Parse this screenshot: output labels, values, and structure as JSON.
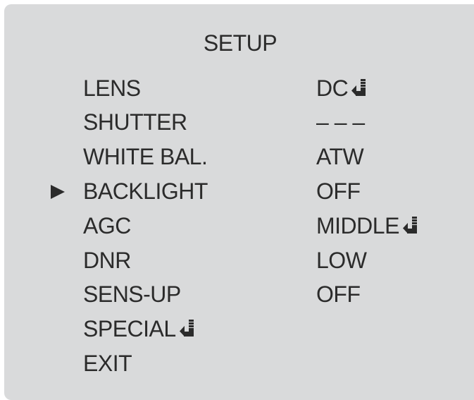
{
  "menu": {
    "title": "SETUP",
    "selected_index": 3,
    "items": [
      {
        "label": "LENS",
        "value": "DC",
        "label_has_submenu": false,
        "value_has_submenu": true
      },
      {
        "label": "SHUTTER",
        "value": "– – –",
        "label_has_submenu": false,
        "value_has_submenu": false
      },
      {
        "label": "WHITE BAL.",
        "value": "ATW",
        "label_has_submenu": false,
        "value_has_submenu": false
      },
      {
        "label": "BACKLIGHT",
        "value": "OFF",
        "label_has_submenu": false,
        "value_has_submenu": false
      },
      {
        "label": "AGC",
        "value": "MIDDLE",
        "label_has_submenu": false,
        "value_has_submenu": true
      },
      {
        "label": "DNR",
        "value": "LOW",
        "label_has_submenu": false,
        "value_has_submenu": false
      },
      {
        "label": "SENS-UP",
        "value": "OFF",
        "label_has_submenu": false,
        "value_has_submenu": false
      },
      {
        "label": "SPECIAL",
        "value": "",
        "label_has_submenu": true,
        "value_has_submenu": false
      },
      {
        "label": "EXIT",
        "value": "",
        "label_has_submenu": false,
        "value_has_submenu": false
      }
    ]
  },
  "icons": {
    "cursor": "selection-arrow-icon",
    "submenu": "enter-icon"
  },
  "colors": {
    "panel_background": "#d9dadb",
    "text": "#2b2b2b"
  }
}
